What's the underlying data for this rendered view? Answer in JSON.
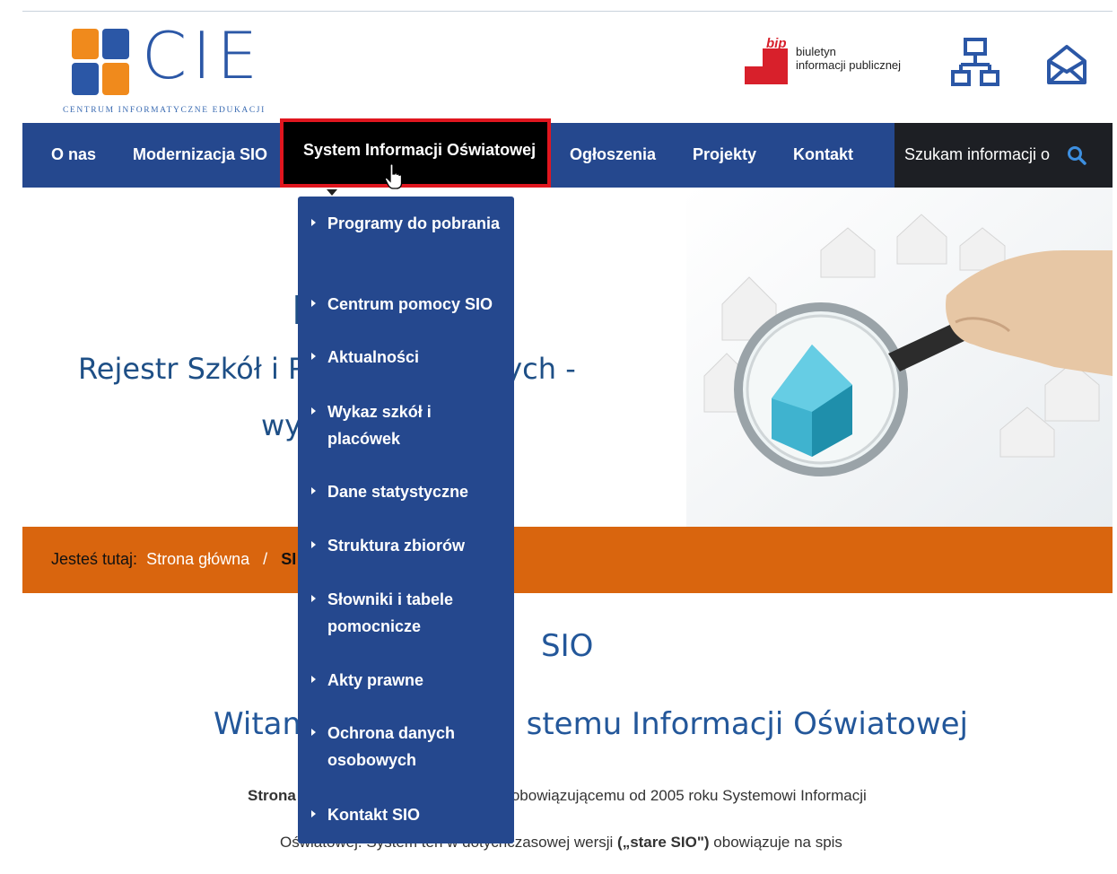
{
  "header": {
    "logo_text": "CIE",
    "logo_subtitle": "CENTRUM INFORMATYCZNE EDUKACJI",
    "bip_word": "bip",
    "bip_line1": "biuletyn",
    "bip_line2": "informacji publicznej",
    "icons": [
      "sitemap-icon",
      "mail-icon"
    ]
  },
  "nav": {
    "items": [
      {
        "label": "O nas"
      },
      {
        "label": "Modernizacja SIO"
      },
      {
        "label": "System Informacji Oświatowej"
      },
      {
        "label": "Ogłoszenia"
      },
      {
        "label": "Projekty"
      },
      {
        "label": "Kontakt"
      }
    ],
    "active_index": 2,
    "search_placeholder": "Szukam informacji o"
  },
  "dropdown": {
    "items": [
      {
        "label": "Programy do pobrania"
      },
      {
        "label": "Centrum pomocy SIO"
      },
      {
        "label": "Aktualności"
      },
      {
        "label": "Wykaz szkół i placówek"
      },
      {
        "label": "Dane statystyczne"
      },
      {
        "label": "Struktura zbiorów"
      },
      {
        "label": "Słowniki i tabele pomocnicze"
      },
      {
        "label": "Akty prawne"
      },
      {
        "label": "Ochrona danych osobowych"
      },
      {
        "label": "Kontakt SIO"
      }
    ]
  },
  "hero": {
    "title_fragment": "R",
    "line1_left": "Rejestr Szkół i P",
    "line1_right": "atowych -",
    "line2_fragment": "wy"
  },
  "breadcrumb": {
    "prefix": "Jesteś tutaj:",
    "home": "Strona główna",
    "separator": "/",
    "current": "SI"
  },
  "content": {
    "title": "SIO",
    "welcome_left": "Witam",
    "welcome_right": "stemu Informacji Oświatowej",
    "para1_left": "Strona",
    "para1_right": "obowiązującemu od 2005 roku Systemowi Informacji",
    "para2_pre": "Oświatowej. System ten w dotychczasowej wersji ",
    "para2_bold": "(„stare SIO\")",
    "para2_post": " obowiązuje na spis"
  },
  "colors": {
    "nav_bg": "#25488e",
    "active_bg": "#000000",
    "active_border": "#e0161f",
    "breadcrumb_bg": "#d9650e",
    "heading": "#23579a"
  }
}
